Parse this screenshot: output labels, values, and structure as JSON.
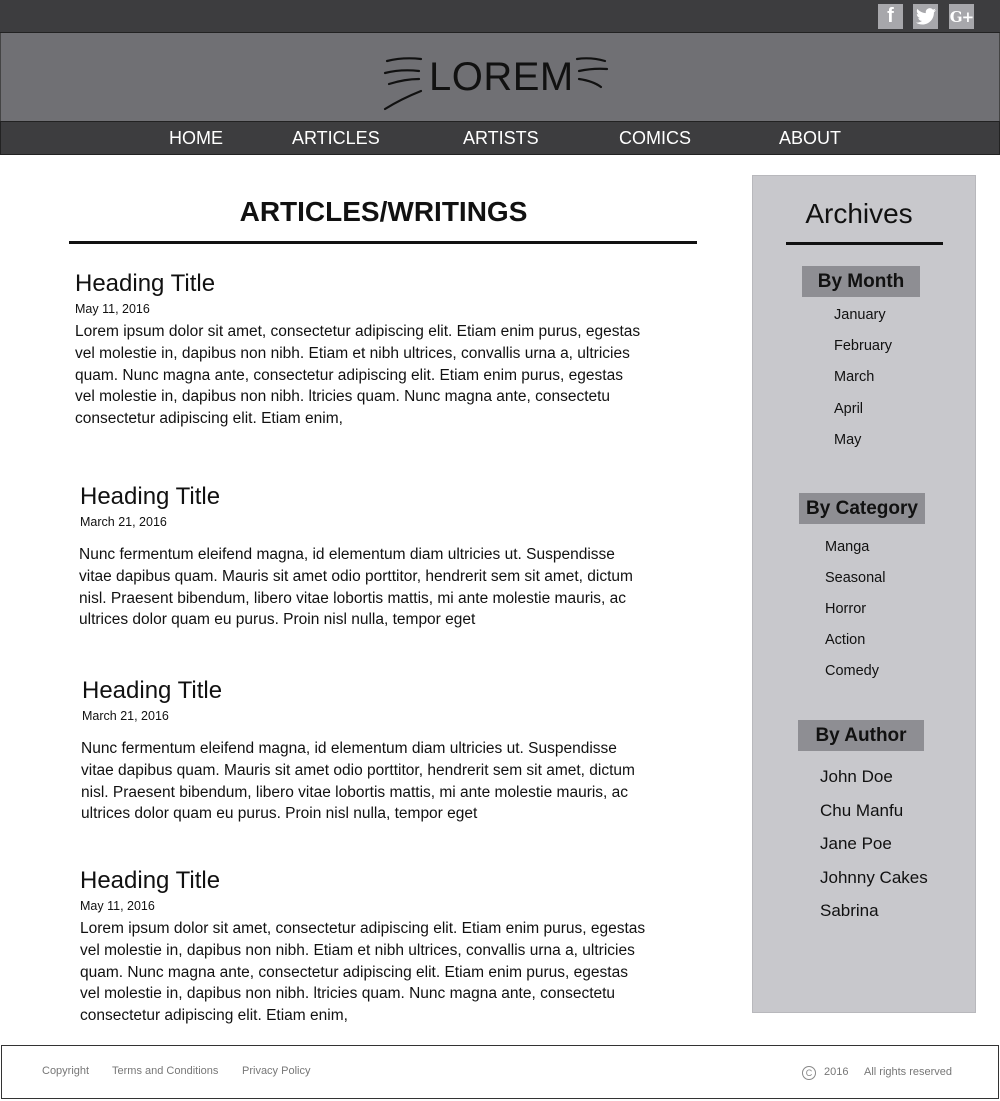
{
  "social": {
    "facebook": "f",
    "twitter": "twitter-bird",
    "google_plus": "G+"
  },
  "logo": {
    "text": "LOREM"
  },
  "nav": [
    {
      "label": "HOME"
    },
    {
      "label": "ARTICLES"
    },
    {
      "label": "ARTISTS"
    },
    {
      "label": "COMICS"
    },
    {
      "label": "ABOUT"
    }
  ],
  "main": {
    "title": "ARTICLES/WRITINGS",
    "articles": [
      {
        "title": "Heading Title",
        "date": "May 11, 2016",
        "lines": [
          "Lorem ipsum dolor sit amet, consectetur adipiscing elit. Etiam enim purus, egestas",
          "vel molestie in, dapibus non nibh. Etiam et nibh ultrices, convallis urna a, ultricies",
          "quam. Nunc magna ante,  consectetur adipiscing elit. Etiam enim purus, egestas",
          "vel molestie in, dapibus non nibh. ltricies quam. Nunc magna ante,  consectetu",
          "consectetur adipiscing elit. Etiam enim,"
        ]
      },
      {
        "title": "Heading Title",
        "date": "March 21, 2016",
        "lines": [
          "Nunc fermentum eleifend magna, id elementum diam ultricies ut. Suspendisse",
          "vitae dapibus quam. Mauris sit amet odio porttitor, hendrerit sem sit amet, dictum",
          "nisl. Praesent bibendum, libero vitae lobortis mattis, mi ante molestie mauris, ac",
          "ultrices dolor quam eu purus. Proin nisl nulla, tempor eget"
        ]
      },
      {
        "title": "Heading Title",
        "date": "March 21, 2016",
        "lines": [
          "Nunc fermentum eleifend magna, id elementum diam ultricies ut. Suspendisse",
          "vitae dapibus quam. Mauris sit amet odio porttitor, hendrerit sem sit amet, dictum",
          "nisl. Praesent bibendum, libero vitae lobortis mattis, mi ante molestie mauris, ac",
          "ultrices dolor quam eu purus. Proin nisl nulla, tempor eget"
        ]
      },
      {
        "title": "Heading Title",
        "date": "May 11, 2016",
        "lines": [
          "Lorem ipsum dolor sit amet, consectetur adipiscing elit. Etiam enim purus, egestas",
          "vel molestie in, dapibus non nibh. Etiam et nibh ultrices, convallis urna a, ultricies",
          "quam. Nunc magna ante,  consectetur adipiscing elit. Etiam enim purus, egestas",
          "vel molestie in, dapibus non nibh. ltricies quam. Nunc magna ante,  consectetu",
          "consectetur adipiscing elit. Etiam enim,"
        ]
      }
    ]
  },
  "sidebar": {
    "title": "Archives",
    "by_month": {
      "label": "By Month",
      "items": [
        "January",
        "February",
        "March",
        "April",
        "May"
      ]
    },
    "by_category": {
      "label": "By Category",
      "items": [
        "Manga",
        "Seasonal",
        "Horror",
        "Action",
        "Comedy"
      ]
    },
    "by_author": {
      "label": "By Author",
      "items": [
        "John Doe",
        "Chu Manfu",
        "Jane Poe",
        "Johnny Cakes",
        "Sabrina"
      ]
    }
  },
  "footer": {
    "links": [
      "Copyright",
      "Terms and Conditions",
      "Privacy Policy"
    ],
    "copyright_symbol": "C",
    "year": "2016",
    "rights": "All rights reserved"
  },
  "colors": {
    "topbar": "#3d3d3f",
    "logoband": "#707074",
    "sidebar": "#c8c8cc",
    "label_bg": "#8e8e93"
  }
}
